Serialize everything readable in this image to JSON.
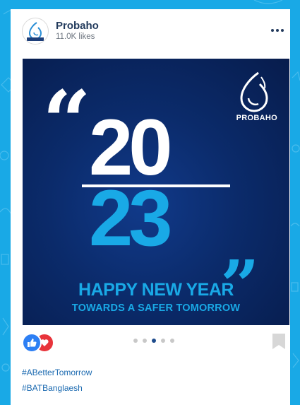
{
  "page": {
    "name": "Probaho",
    "likes": "11.0K likes"
  },
  "post": {
    "brand_text": "PROBAHO",
    "quote_open": "“",
    "year_top": "20",
    "year_bottom": "23",
    "quote_close": "„",
    "headline": "HAPPY NEW YEAR",
    "subline": "TOWARDS A SAFER TOMORROW",
    "carousel_total": 5,
    "carousel_active": 3
  },
  "hashtags": [
    "#ABetterTomorrow",
    "#BATBanglaesh"
  ],
  "colors": {
    "background": "#19a9e6",
    "title": "#233b5d",
    "accent_blue": "#19a9e6",
    "like": "#2d7ff4",
    "love": "#e8343b"
  }
}
